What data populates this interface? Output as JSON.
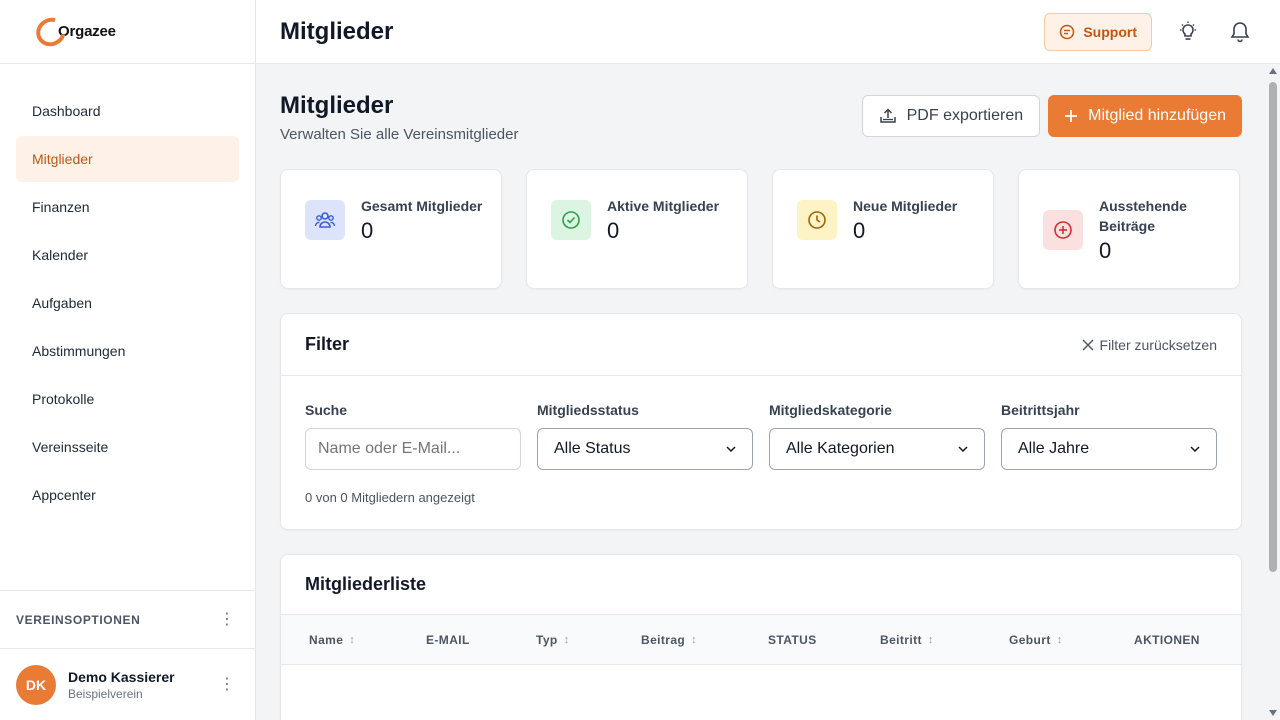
{
  "app": {
    "name": "Orgazee"
  },
  "sidebar": {
    "items": [
      {
        "label": "Dashboard"
      },
      {
        "label": "Mitglieder"
      },
      {
        "label": "Finanzen"
      },
      {
        "label": "Kalender"
      },
      {
        "label": "Aufgaben"
      },
      {
        "label": "Abstimmungen"
      },
      {
        "label": "Protokolle"
      },
      {
        "label": "Vereinsseite"
      },
      {
        "label": "Appcenter"
      }
    ],
    "active": "Mitglieder",
    "section_label": "VEREINSOPTIONEN",
    "user": {
      "initials": "DK",
      "name": "Demo Kassierer",
      "club": "Beispielverein"
    }
  },
  "topbar": {
    "title": "Mitglieder",
    "support_label": "Support"
  },
  "page": {
    "title": "Mitglieder",
    "subtitle": "Verwalten Sie alle Vereinsmitglieder",
    "export_label": "PDF exportieren",
    "add_label": "Mitglied hinzufügen"
  },
  "stats": [
    {
      "label": "Gesamt Mitglieder",
      "value": "0",
      "icon": "users-icon",
      "color": "#dbe4fb"
    },
    {
      "label": "Aktive Mitglieder",
      "value": "0",
      "icon": "check-circle-icon",
      "color": "#dcf5e3"
    },
    {
      "label": "Neue Mitglieder",
      "value": "0",
      "icon": "clock-icon",
      "color": "#fdf3c4"
    },
    {
      "label": "Ausstehende Beiträge",
      "value": "0",
      "icon": "plus-circle-icon",
      "color": "#fbe0e0"
    }
  ],
  "filter": {
    "title": "Filter",
    "reset_label": "Filter zurücksetzen",
    "search_label": "Suche",
    "search_placeholder": "Name oder E-Mail...",
    "status_label": "Mitgliedsstatus",
    "status_value": "Alle Status",
    "category_label": "Mitgliedskategorie",
    "category_value": "Alle Kategorien",
    "year_label": "Beitrittsjahr",
    "year_value": "Alle Jahre",
    "count_text": "0 von 0 Mitgliedern angezeigt"
  },
  "list": {
    "title": "Mitgliederliste",
    "columns": [
      "Name",
      "E-MAIL",
      "Typ",
      "Beitrag",
      "STATUS",
      "Beitritt",
      "Geburt",
      "AKTIONEN"
    ]
  },
  "colors": {
    "accent": "#ea7b35",
    "accent_bg": "#fdf1e8",
    "accent_text": "#c2560f"
  }
}
